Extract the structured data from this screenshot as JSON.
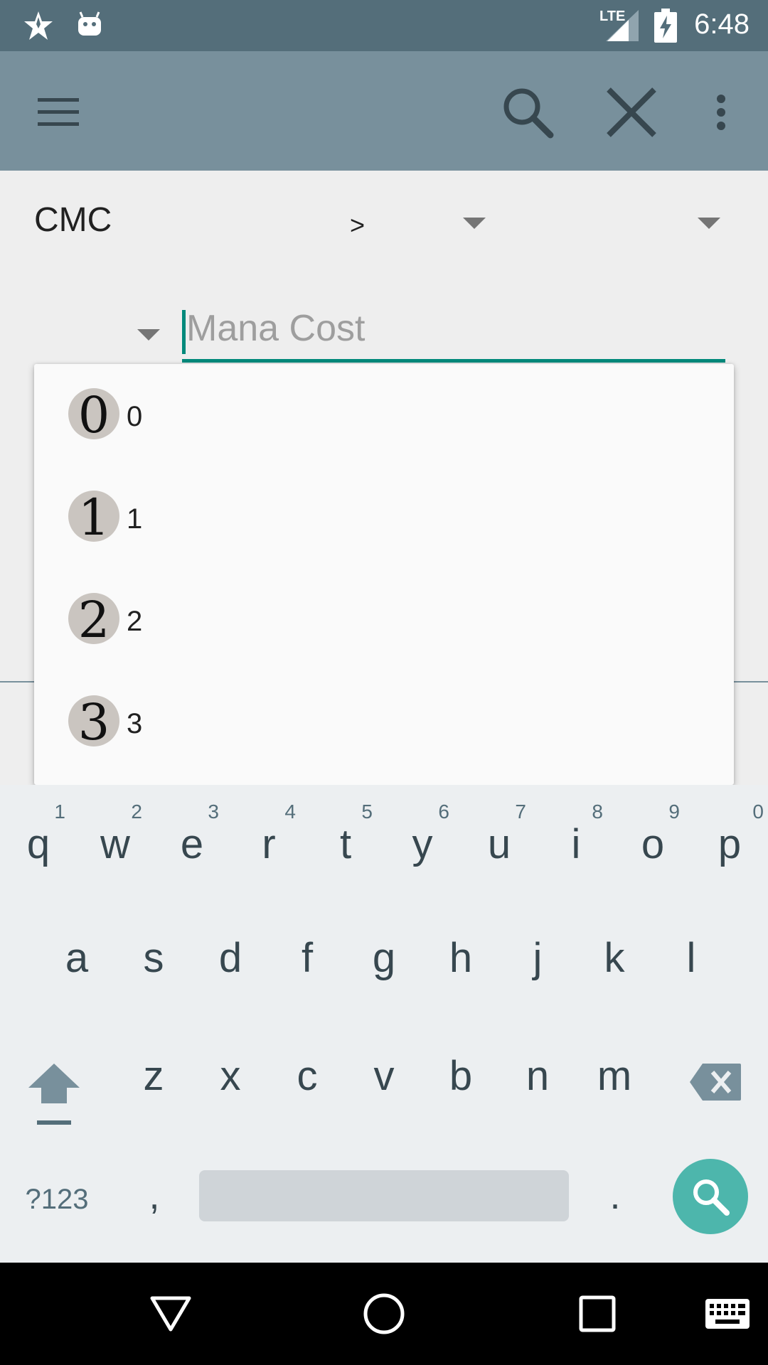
{
  "status_bar": {
    "time": "6:48",
    "network": "LTE"
  },
  "app_bar": {
    "icons": [
      "menu-icon",
      "search-icon",
      "close-icon",
      "more-vert-icon"
    ]
  },
  "filter": {
    "field_label": "CMC",
    "operator": ">",
    "mana_cost_placeholder": "Mana Cost"
  },
  "dropdown": {
    "items": [
      {
        "symbol": "0",
        "label": "0"
      },
      {
        "symbol": "1",
        "label": "1"
      },
      {
        "symbol": "2",
        "label": "2"
      },
      {
        "symbol": "3",
        "label": "3"
      }
    ]
  },
  "keyboard": {
    "row1": [
      {
        "key": "q",
        "hint": "1"
      },
      {
        "key": "w",
        "hint": "2"
      },
      {
        "key": "e",
        "hint": "3"
      },
      {
        "key": "r",
        "hint": "4"
      },
      {
        "key": "t",
        "hint": "5"
      },
      {
        "key": "y",
        "hint": "6"
      },
      {
        "key": "u",
        "hint": "7"
      },
      {
        "key": "i",
        "hint": "8"
      },
      {
        "key": "o",
        "hint": "9"
      },
      {
        "key": "p",
        "hint": "0"
      }
    ],
    "row2": [
      "a",
      "s",
      "d",
      "f",
      "g",
      "h",
      "j",
      "k",
      "l"
    ],
    "row3": [
      "z",
      "x",
      "c",
      "v",
      "b",
      "n",
      "m"
    ],
    "symbols_label": "?123",
    "comma": ",",
    "period": "."
  },
  "colors": {
    "status_bar": "#546e7a",
    "app_bar": "#78909c",
    "accent": "#00897b",
    "search_key": "#4db6ac"
  }
}
